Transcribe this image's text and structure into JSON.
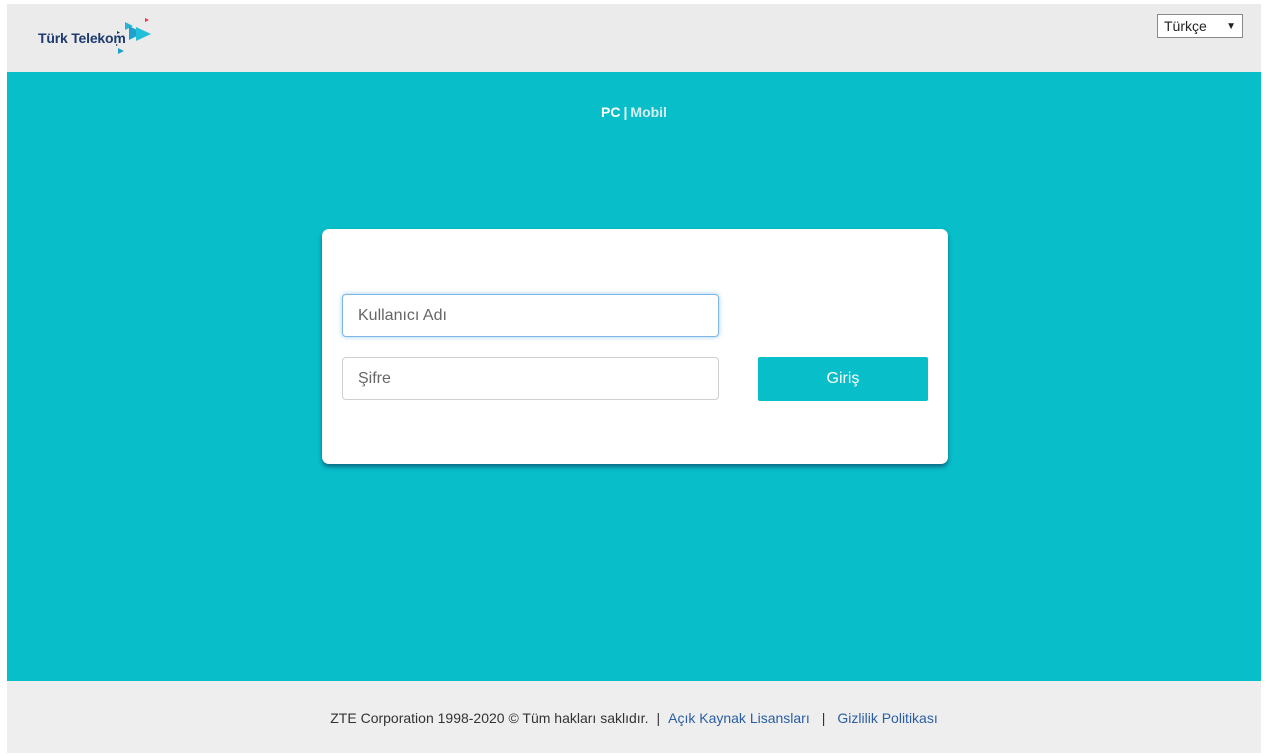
{
  "header": {
    "logo_text": "Türk Telekom",
    "language": {
      "selected": "Türkçe",
      "arrow": "▼"
    }
  },
  "mode_switch": {
    "pc": "PC",
    "separator": "|",
    "mobil": "Mobil"
  },
  "login": {
    "username_placeholder": "Kullanıcı Adı",
    "password_placeholder": "Şifre",
    "submit_label": "Giriş"
  },
  "footer": {
    "copyright": "ZTE Corporation 1998-2020 © Tüm hakları saklıdır.",
    "separator": "|",
    "licenses_link": "Açık Kaynak Lisansları",
    "privacy_link": "Gizlilik Politikası"
  },
  "colors": {
    "brand_teal": "#07bec9",
    "logo_navy": "#1e3a6f",
    "link_blue": "#2a5ea3"
  }
}
